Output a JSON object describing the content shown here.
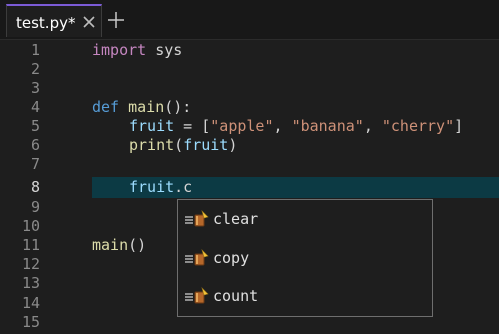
{
  "tab": {
    "title": "test.py*"
  },
  "line_numbers": [
    "1",
    "2",
    "3",
    "4",
    "5",
    "6",
    "7",
    "8",
    "9",
    "10",
    "11",
    "12",
    "13",
    "14",
    "15"
  ],
  "active_line": "8",
  "code": {
    "line1": {
      "keyword": "import",
      "module": "sys"
    },
    "line4": {
      "keyword": "def",
      "name": "main",
      "punct": "():"
    },
    "line5": {
      "var": "fruit",
      "op": " = [",
      "s1": "\"apple\"",
      "sep1": ", ",
      "s2": "\"banana\"",
      "sep2": ", ",
      "s3": "\"cherry\"",
      "close": "]"
    },
    "line6": {
      "fn": "print",
      "open": "(",
      "arg": "fruit",
      "close": ")"
    },
    "line8": {
      "var": "fruit",
      "rest": ".c"
    },
    "line11": {
      "fn": "main",
      "punct": "()"
    }
  },
  "suggestions": [
    {
      "label": "clear",
      "icon": "method-icon"
    },
    {
      "label": "copy",
      "icon": "method-icon"
    },
    {
      "label": "count",
      "icon": "method-icon"
    }
  ],
  "colors": {
    "accent": "#7b5bd6",
    "keyword": "#c586c0",
    "def_keyword": "#569cd6",
    "function": "#dcdcaa",
    "string": "#ce9178",
    "variable": "#9cdcfe",
    "current_line": "#0c3a44"
  }
}
